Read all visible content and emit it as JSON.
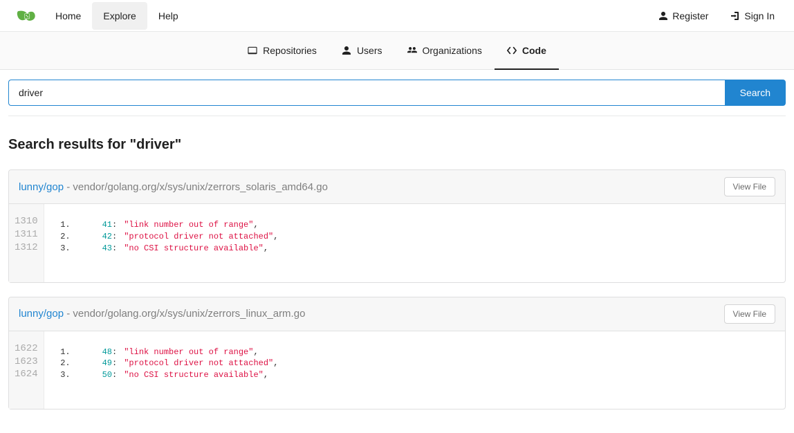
{
  "top_nav": {
    "home": "Home",
    "explore": "Explore",
    "help": "Help",
    "register": "Register",
    "sign_in": "Sign In"
  },
  "tabs": {
    "repositories": "Repositories",
    "users": "Users",
    "organizations": "Organizations",
    "code": "Code"
  },
  "search": {
    "value": "driver",
    "button": "Search"
  },
  "results_title": "Search results for \"driver\"",
  "view_file_label": "View File",
  "results": [
    {
      "repo": "lunny/gop",
      "sep": " - ",
      "path": "vendor/golang.org/x/sys/unix/zerrors_solaris_amd64.go",
      "file_lines": [
        "1310",
        "1311",
        "1312"
      ],
      "lines": [
        {
          "idx": "1.",
          "key": "41",
          "str": "\"link number out of range\""
        },
        {
          "idx": "2.",
          "key": "42",
          "str": "\"protocol driver not attached\""
        },
        {
          "idx": "3.",
          "key": "43",
          "str": "\"no CSI structure available\""
        }
      ]
    },
    {
      "repo": "lunny/gop",
      "sep": " - ",
      "path": "vendor/golang.org/x/sys/unix/zerrors_linux_arm.go",
      "file_lines": [
        "1622",
        "1623",
        "1624"
      ],
      "lines": [
        {
          "idx": "1.",
          "key": "48",
          "str": "\"link number out of range\""
        },
        {
          "idx": "2.",
          "key": "49",
          "str": "\"protocol driver not attached\""
        },
        {
          "idx": "3.",
          "key": "50",
          "str": "\"no CSI structure available\""
        }
      ]
    }
  ]
}
